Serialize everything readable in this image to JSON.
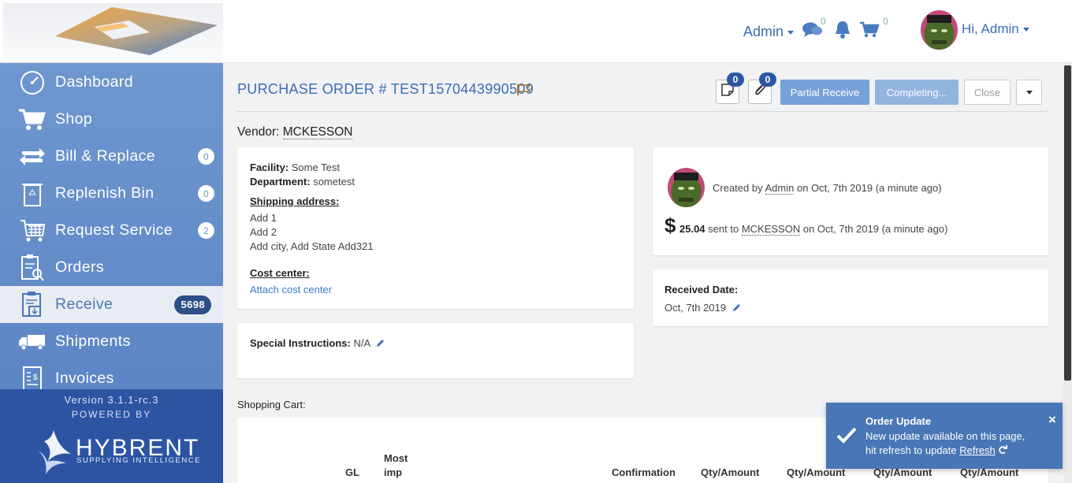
{
  "topbar": {
    "admin_menu": "Admin",
    "messages_count": "0",
    "cart_count": "0",
    "user_greeting": "Hi, Admin"
  },
  "sidebar": {
    "items": [
      {
        "label": "Dashboard",
        "icon": "dashboard-icon",
        "badge": ""
      },
      {
        "label": "Shop",
        "icon": "cart-icon",
        "badge": ""
      },
      {
        "label": "Bill & Replace",
        "icon": "bill-replace-icon",
        "badge": "0"
      },
      {
        "label": "Replenish Bin",
        "icon": "recycle-bin-icon",
        "badge": "0"
      },
      {
        "label": "Request Service",
        "icon": "request-service-icon",
        "badge": "2"
      },
      {
        "label": "Orders",
        "icon": "orders-icon",
        "badge": ""
      },
      {
        "label": "Receive",
        "icon": "receive-icon",
        "badge": "5698"
      },
      {
        "label": "Shipments",
        "icon": "truck-icon",
        "badge": ""
      },
      {
        "label": "Invoices",
        "icon": "invoice-icon",
        "badge": ""
      }
    ],
    "footer": {
      "version": "Version 3.1.1-rc.3",
      "powered_by": "POWERED BY",
      "brand": "HYBRENT",
      "tagline": "SUPPLYING INTELLIGENCE"
    }
  },
  "header": {
    "title": "PURCHASE ORDER # TEST1570443990509",
    "notes_count": "0",
    "attachments_count": "0",
    "btn_partial": "Partial Receive",
    "btn_completing": "Completing...",
    "btn_close": "Close"
  },
  "vendor": {
    "label": "Vendor:",
    "name": "MCKESSON"
  },
  "facility_card": {
    "facility_label": "Facility:",
    "facility": "Some Test",
    "department_label": "Department:",
    "department": "sometest",
    "shipping_label": "Shipping address:",
    "address_lines": [
      "Add 1",
      "Add 2",
      "Add city, Add State Add321"
    ],
    "cost_center_label": "Cost center:",
    "cost_center_link": "Attach cost center"
  },
  "special": {
    "label": "Special Instructions:",
    "value": "N/A"
  },
  "activity": {
    "created_prefix": "Created by",
    "created_user": "Admin",
    "created_suffix": "on Oct, 7th 2019 (a minute ago)",
    "dollar": "$",
    "amount": "25.04",
    "sent_prefix": "sent to",
    "sent_vendor": "MCKESSON",
    "sent_suffix": "on Oct, 7th 2019 (a minute ago)"
  },
  "received": {
    "label": "Received Date:",
    "value": "Oct, 7th 2019"
  },
  "cart": {
    "label": "Shopping Cart:",
    "columns": [
      "GL",
      "Most",
      "imp",
      "Confirmation",
      "Qty/Amount",
      "Qty/Amount",
      "Qty/Amount",
      "Qty/Amount"
    ]
  },
  "toast": {
    "title": "Order Update",
    "line1": "New update available on this page,",
    "line2": "hit refresh to update",
    "link": "Refresh"
  }
}
